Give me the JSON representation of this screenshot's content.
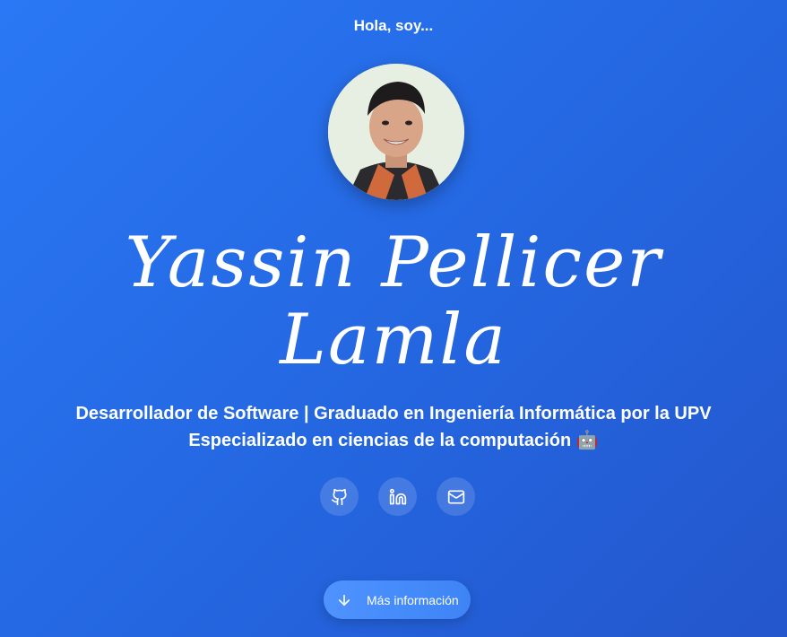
{
  "hero": {
    "greeting": "Hola, soy...",
    "name_line_1": "Yassin Pellicer",
    "name_line_2": "Lamla",
    "subtitle_line_1": "Desarrollador de Software | Graduado en Ingeniería Informática por la UPV",
    "subtitle_line_2": "Especializado en ciencias de la computación",
    "subtitle_emoji": "🤖"
  },
  "social_links": [
    {
      "icon": "github-icon"
    },
    {
      "icon": "linkedin-icon"
    },
    {
      "icon": "mail-icon"
    }
  ],
  "more_button": {
    "label": "Más información",
    "icon": "arrow-down-icon"
  },
  "colors": {
    "background_start": "#2a78f5",
    "background_end": "#2456cc",
    "button": "#4e93ff",
    "text": "#ffffff"
  }
}
